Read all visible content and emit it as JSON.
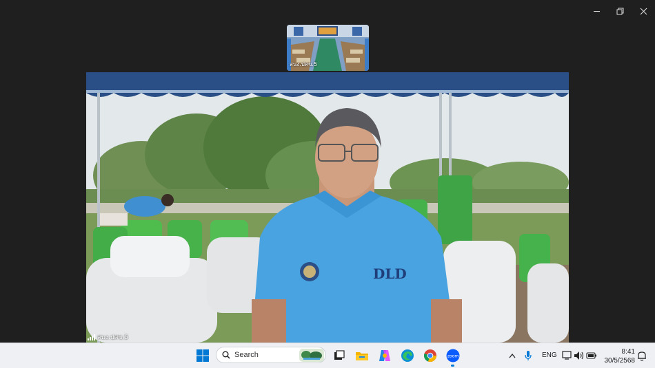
{
  "thumbnail": {
    "participant_name": "สนง.ปศข.5"
  },
  "main_video": {
    "participant_name": "สนง.ปศข.5",
    "shirt_text": "DLD"
  },
  "taskbar": {
    "search_placeholder": "Search",
    "language": "ENG",
    "time": "8:41",
    "date": "30/5/2568",
    "pinned": [
      "windows-start",
      "search",
      "task-view",
      "file-explorer",
      "copilot",
      "edge",
      "chrome",
      "zoom"
    ]
  },
  "colors": {
    "background": "#1f1f1f",
    "taskbar": "#eef0f4",
    "accent": "#0078d4",
    "zoom_blue": "#0b5cff"
  }
}
